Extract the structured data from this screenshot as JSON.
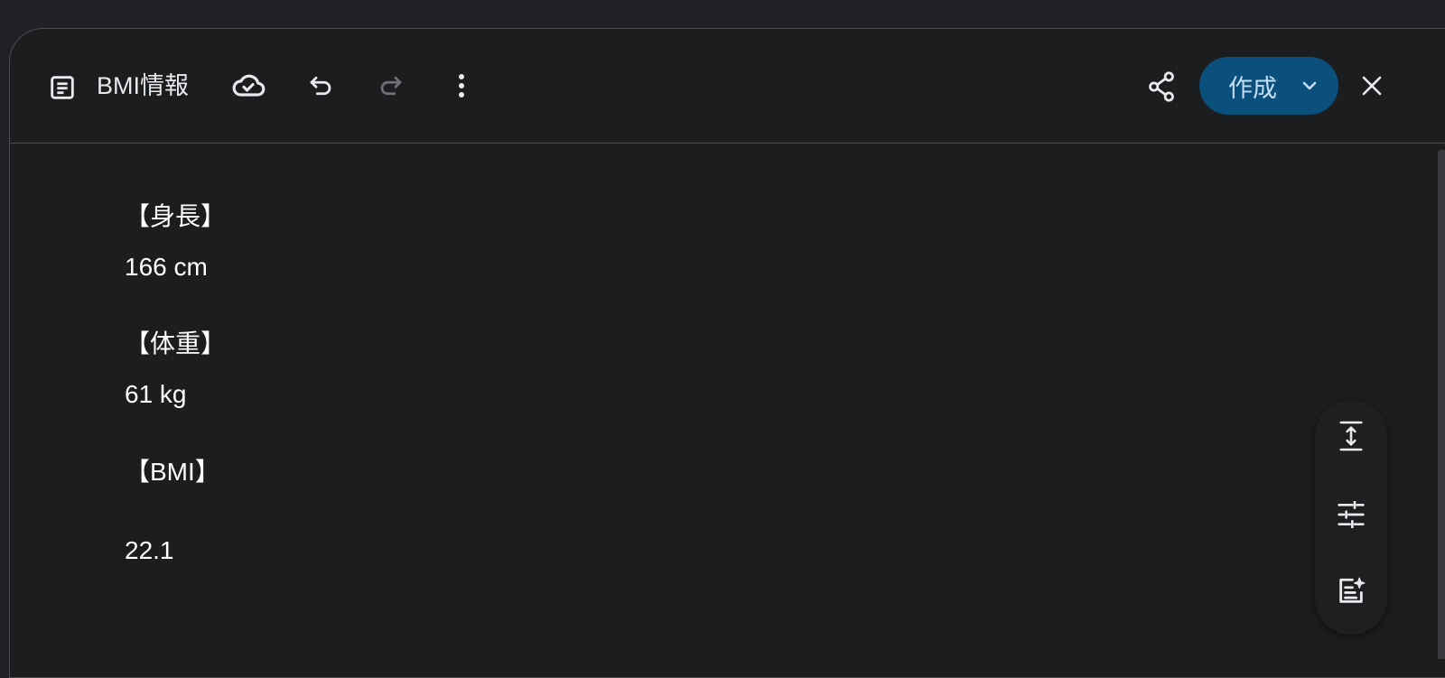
{
  "header": {
    "doc_icon": "document-icon",
    "title": "BMI情報",
    "create_label": "作成"
  },
  "content": {
    "height_heading": "【身長】",
    "height_value": "166 cm",
    "weight_heading": "【体重】",
    "weight_value": "61 kg",
    "bmi_heading": "【BMI】",
    "bmi_value": "22.1"
  },
  "colors": {
    "background": "#1c1d1f",
    "accent_button": "#0b4f7c",
    "accent_text": "#c5ddf2"
  },
  "icons": {
    "toolbar": [
      "document-icon",
      "cloud-saved-icon",
      "undo-icon",
      "redo-icon",
      "more-vert-icon",
      "share-icon",
      "chevron-down-icon",
      "close-icon"
    ],
    "side_tools": [
      "line-spacing-icon",
      "tune-icon",
      "ai-notes-icon"
    ]
  }
}
